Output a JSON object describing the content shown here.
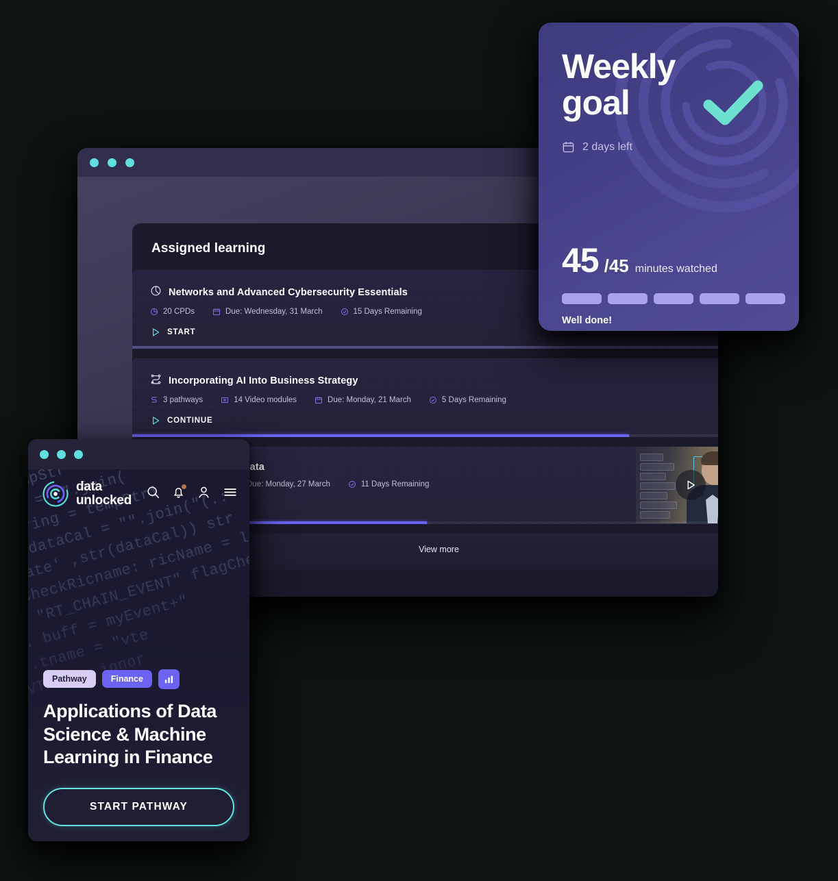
{
  "desktop": {
    "window_dots": [
      "dot-1",
      "dot-2",
      "dot-3"
    ],
    "section_title": "Assigned learning",
    "view_more_label": "View more",
    "cards": [
      {
        "icon": "pie-chart-icon",
        "title": "Networks and Advanced Cybersecurity Essentials",
        "meta": [
          {
            "icon": "cpd-icon",
            "text": "20 CPDs"
          },
          {
            "icon": "calendar-icon",
            "text": "Due: Wednesday, 31 March"
          },
          {
            "icon": "check-circle-icon",
            "text": "15 Days Remaining"
          }
        ],
        "action": {
          "icon": "play-icon",
          "label": "START"
        },
        "progress": 100,
        "progress_style": "dim"
      },
      {
        "icon": "pathway-icon",
        "title": "Incorporating AI Into Business Strategy",
        "meta": [
          {
            "icon": "pathway-small-icon",
            "text": "3 pathways"
          },
          {
            "icon": "video-icon",
            "text": "14 Video modules"
          },
          {
            "icon": "calendar-icon",
            "text": "Due: Monday, 21 March"
          },
          {
            "icon": "check-circle-icon",
            "text": "5 Days Remaining"
          }
        ],
        "action": {
          "icon": "play-icon",
          "label": "CONTINUE"
        },
        "progress": 81,
        "progress_style": "bright"
      },
      {
        "icon": "pie-chart-icon",
        "title": "n Data",
        "meta": [
          {
            "icon": "calendar-icon",
            "text": "Due: Monday, 27 March"
          },
          {
            "icon": "check-circle-icon",
            "text": "11 Days Remaining"
          }
        ],
        "action": {
          "icon": "play-icon",
          "label": ""
        },
        "progress": 48,
        "progress_style": "bright",
        "thumbnail": "video-thumbnail-presenter"
      }
    ]
  },
  "weekly_goal": {
    "title": "Weekly goal",
    "calendar_icon": "calendar-icon",
    "days_left": "2 days left",
    "status_icon": "check-mark-icon",
    "current": "45",
    "target": "/45",
    "unit": "minutes watched",
    "segments": 5,
    "note": "Well done!",
    "accent": "#6de0cf",
    "card_bg": "#453f8b"
  },
  "mobile": {
    "window_dots": [
      "dot-1",
      "dot-2",
      "dot-3"
    ],
    "logo": {
      "icon": "data-unlocked-logo-icon",
      "line1": "data",
      "line2": "unlocked"
    },
    "icons": [
      "search-icon",
      "bell-icon",
      "user-icon",
      "menu-icon"
    ],
    "code_background": [
      "ag = tempStr",
      "dataCal = \"\".join(",
      "tempString = tempStri",
      "value dataCal = \"\".join(\"(.:",
      "ck('date' ,str(dataCal)) str",
      "flagCheckRicname:  ricName = lin",
      "tr = \"RT_CHAIN_EVENT\" flagChe",
      "pt\". buff = myEvent+\"",
      "RT'.tname = \"vte",
      "TAVTEST', ignor"
    ],
    "tags": [
      {
        "label": "Pathway",
        "style": "light"
      },
      {
        "label": "Finance",
        "style": "accent"
      }
    ],
    "tag_icon": "bar-chart-icon",
    "title": "Applications of Data Science & Machine Learning in Finance",
    "cta_label": "START PATHWAY",
    "cta_border": "#62e6e0"
  }
}
